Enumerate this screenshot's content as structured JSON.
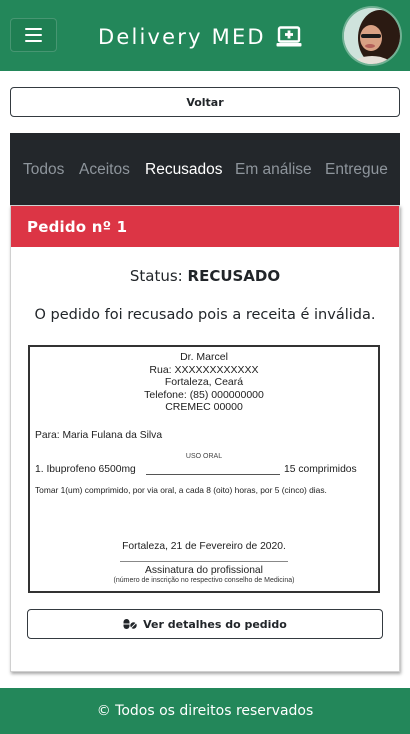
{
  "header": {
    "brand": "Delivery MED",
    "menu_icon": "hamburger-menu-icon",
    "brand_icon": "laptop-medical-icon",
    "avatar": "user-avatar-photo",
    "color": "#23875a"
  },
  "back_button": {
    "label": "Voltar"
  },
  "tabs": [
    {
      "label": "Todos",
      "active": false
    },
    {
      "label": "Aceitos",
      "active": false
    },
    {
      "label": "Recusados",
      "active": true
    },
    {
      "label": "Em análise",
      "active": false
    },
    {
      "label": "Entregue",
      "active": false
    }
  ],
  "order": {
    "title": "Pedido nº 1",
    "status_label": "Status:",
    "status_value": "RECUSADO",
    "reason": "O pedido foi recusado pois a receita é inválida.",
    "header_color": "#dc3545"
  },
  "prescription": {
    "doctor": "Dr. Marcel",
    "street": "Rua: XXXXXXXXXXXX",
    "city": "Fortaleza, Ceará",
    "phone": "Telefone: (85) 000000000",
    "cremec": "CREMEC 00000",
    "patient": "Para: Maria Fulana da Silva",
    "route": "USO ORAL",
    "medication": "1. Ibuprofeno 6500mg",
    "quantity": "15 comprimidos",
    "instructions": "Tomar 1(um) comprimido, por via oral, a cada 8 (oito) horas, por 5 (cinco) dias.",
    "date": "Fortaleza, 21 de Fevereiro de 2020.",
    "signature": "Assinatura do profissional",
    "signature_sub": "(número de inscrição no respectivo conselho de Medicina)"
  },
  "details_button": {
    "label": "Ver detalhes do pedido",
    "icon": "pills-icon"
  },
  "footer": {
    "text": "© Todos os direitos reservados"
  }
}
